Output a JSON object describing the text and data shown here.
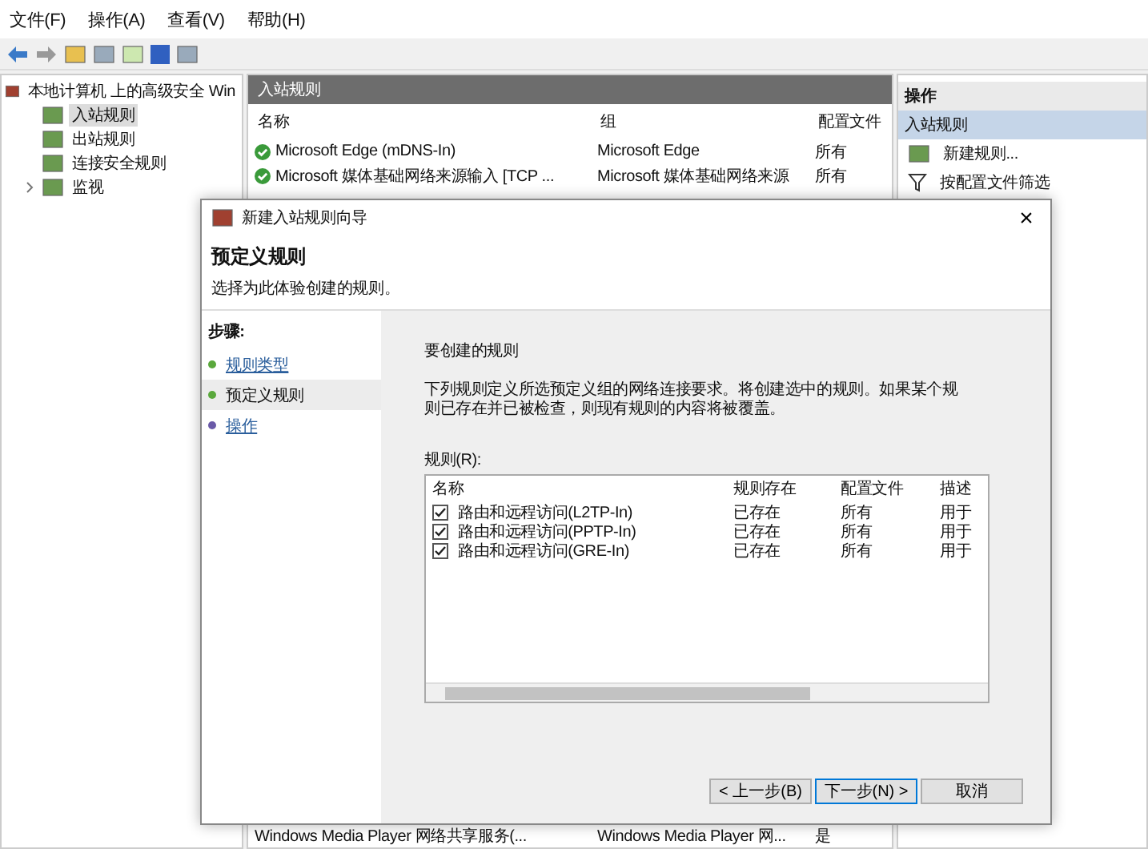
{
  "menu": [
    "文件(F)",
    "操作(A)",
    "查看(V)",
    "帮助(H)"
  ],
  "tree": [
    {
      "label": "本地计算机 上的高级安全 Win",
      "selected": false,
      "children": [
        {
          "label": "入站规则",
          "selected": true
        },
        {
          "label": "出站规则",
          "selected": false
        },
        {
          "label": "连接安全规则",
          "selected": false
        },
        {
          "label": "监视",
          "selected": false,
          "expanded": false
        }
      ]
    }
  ],
  "rules_pane": {
    "title": "入站规则",
    "columns": [
      "名称",
      "组",
      "配置文件"
    ],
    "rows": [
      {
        "name": "Microsoft Edge (mDNS-In)",
        "group": "Microsoft Edge",
        "profile": "所有"
      },
      {
        "name": "Microsoft 媒体基础网络来源输入 [TCP ...",
        "group": "Microsoft 媒体基础网络来源",
        "profile": "所有"
      },
      {
        "name": "Windows Media Player 网络共享服务(...",
        "group": "Windows Media Player 网...",
        "profile": "是"
      }
    ]
  },
  "actions": {
    "title": "操作",
    "section": "入站规则",
    "items": [
      "新建规则...",
      "按配置文件筛选"
    ]
  },
  "dialog": {
    "title": "新建入站规则向导",
    "close": "×",
    "heading": "预定义规则",
    "subtitle": "选择为此体验创建的规则。",
    "steps_label": "步骤:",
    "steps": [
      {
        "label": "规则类型",
        "selected": false,
        "color": "#5aa83c"
      },
      {
        "label": "预定义规则",
        "selected": true,
        "color": "#5aa83c"
      },
      {
        "label": "操作",
        "selected": false,
        "color": "#6a5aa8"
      }
    ],
    "section_title": "要创建的规则",
    "description": "下列规则定义所选预定义组的网络连接要求。将创建选中的规则。如果某个规则已存在并已被检查，则现有规则的内容将被覆盖。",
    "list_label": "规则(R):",
    "list_columns": [
      "名称",
      "规则存在",
      "配置文件",
      "描述"
    ],
    "list_rows": [
      {
        "name": "路由和远程访问(L2TP-In)",
        "exists": "已存在",
        "profile": "所有",
        "description": "用于",
        "checked": true
      },
      {
        "name": "路由和远程访问(PPTP-In)",
        "exists": "已存在",
        "profile": "所有",
        "description": "用于",
        "checked": true
      },
      {
        "name": "路由和远程访问(GRE-In)",
        "exists": "已存在",
        "profile": "所有",
        "description": "用于",
        "checked": true
      }
    ],
    "buttons": [
      {
        "label": "< 上一步(B)",
        "selected": false
      },
      {
        "label": "下一步(N) >",
        "selected": true
      },
      {
        "label": "取消",
        "selected": false
      }
    ]
  }
}
